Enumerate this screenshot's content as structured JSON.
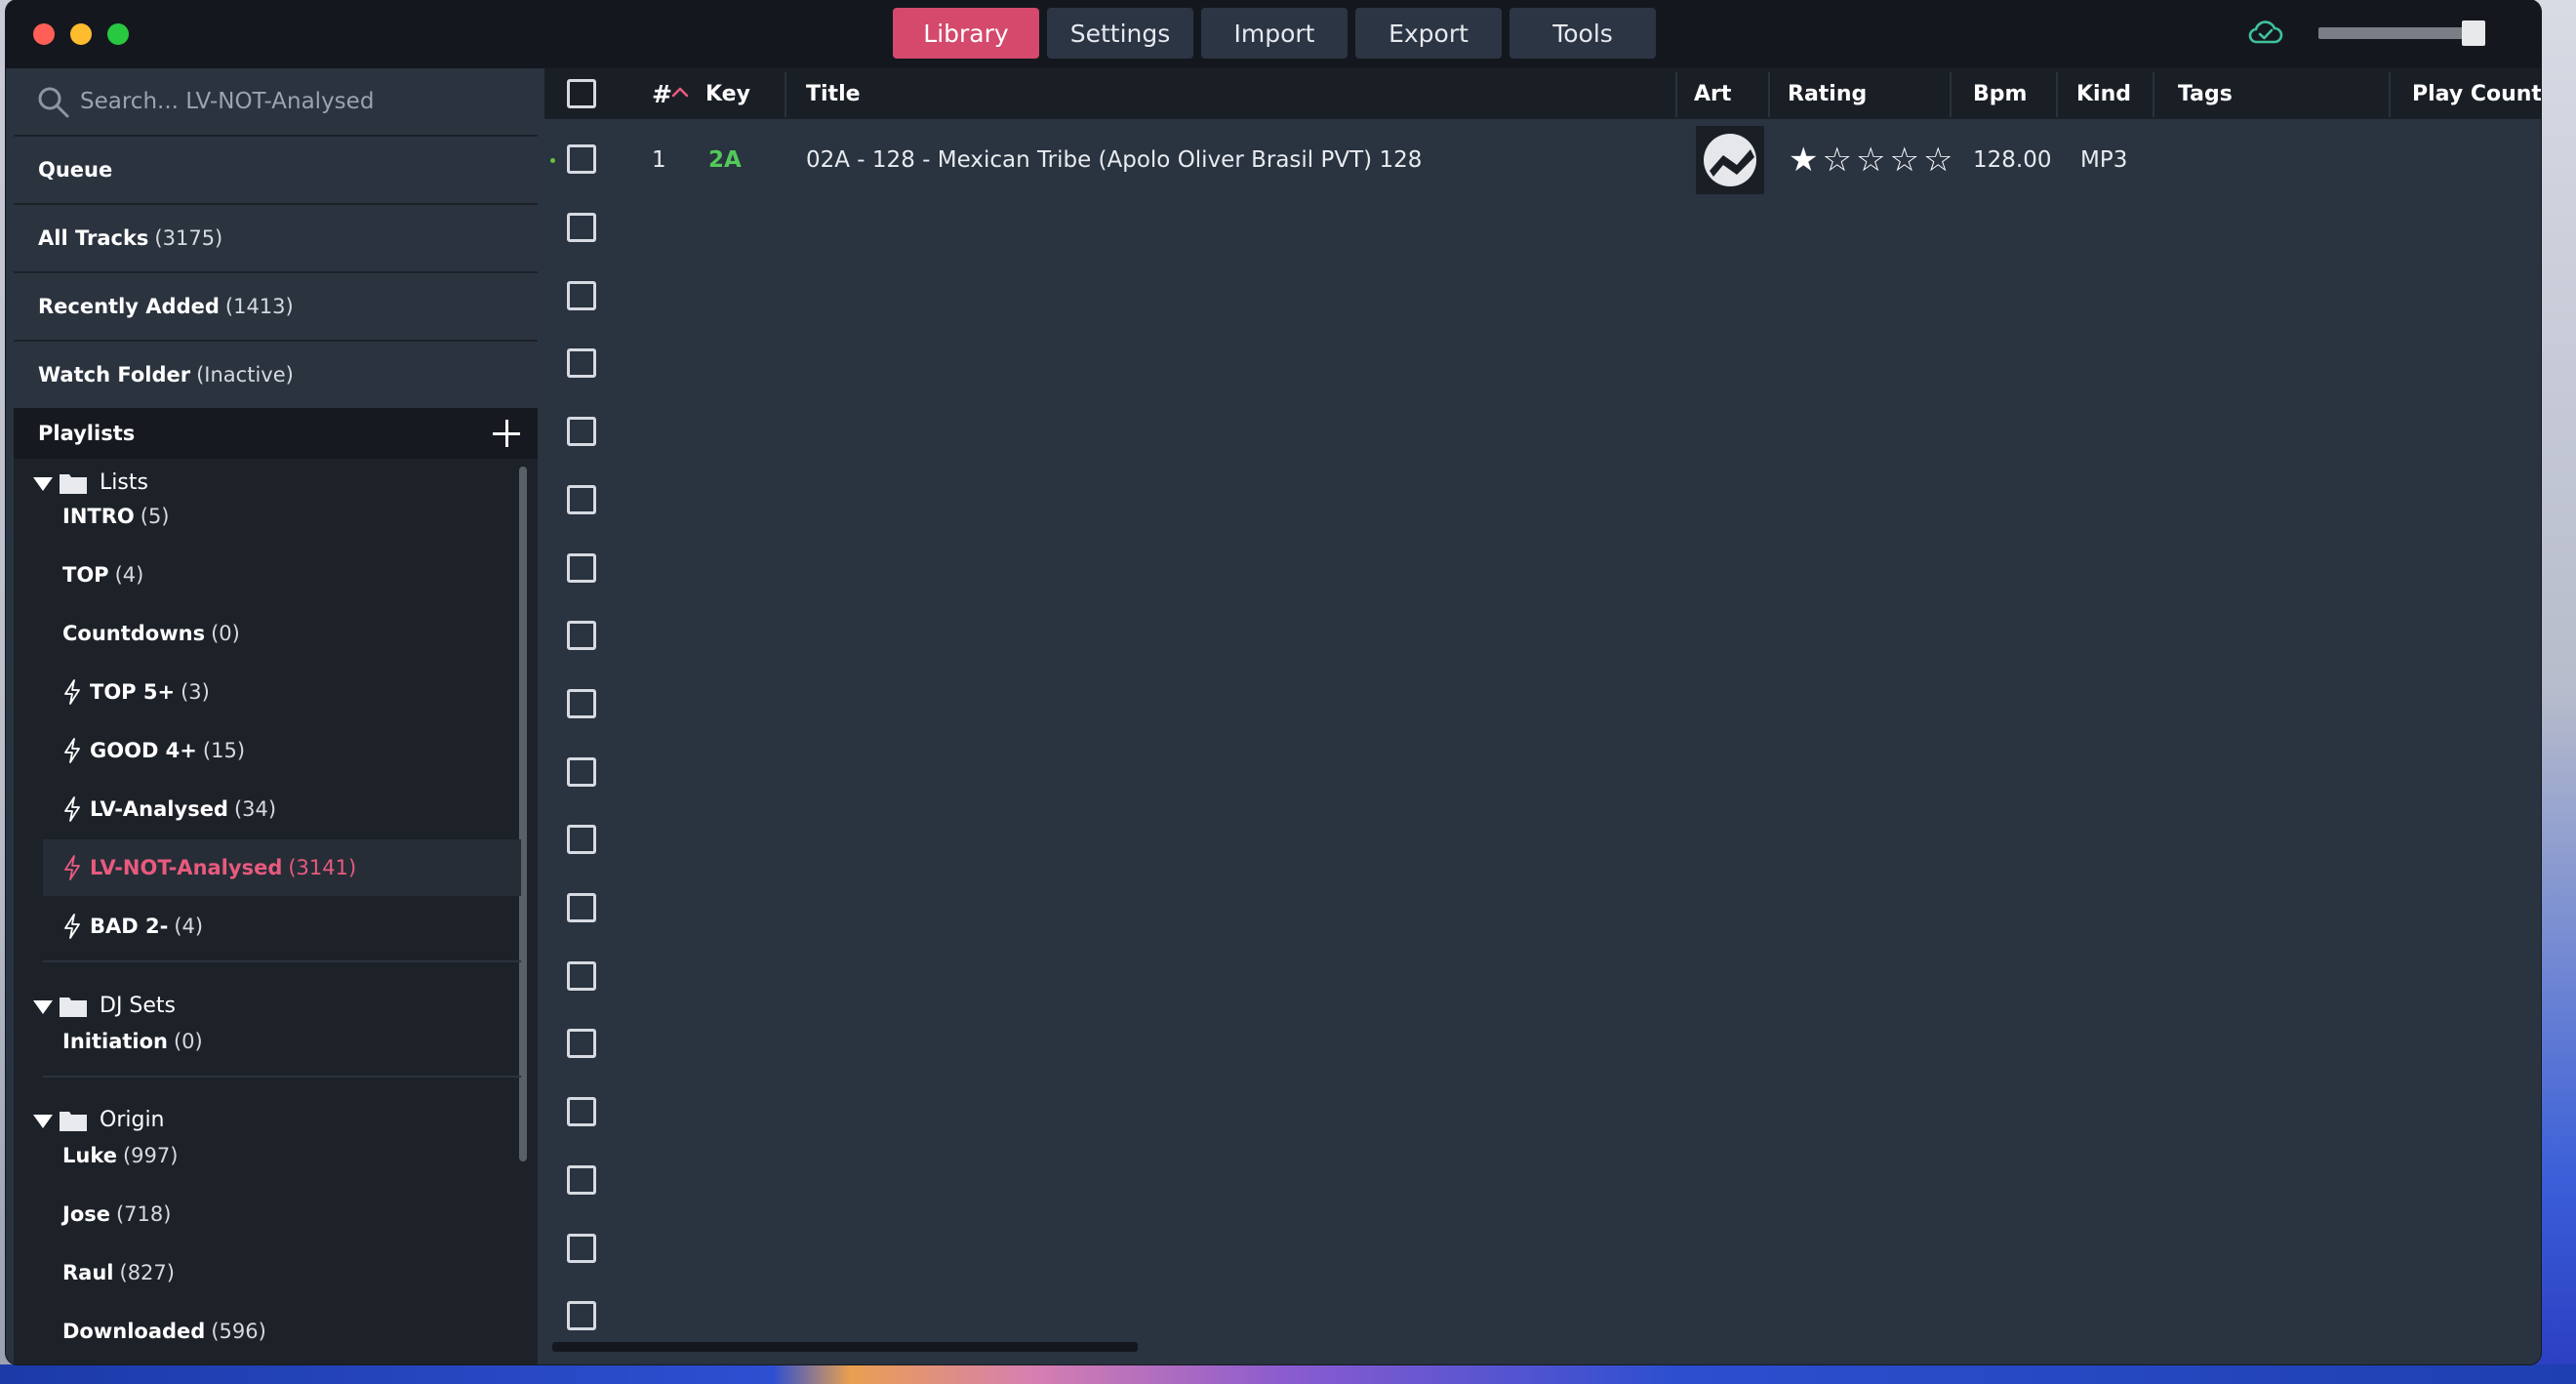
{
  "window": {
    "tabs": [
      {
        "label": "Library",
        "active": true
      },
      {
        "label": "Settings",
        "active": false
      },
      {
        "label": "Import",
        "active": false
      },
      {
        "label": "Export",
        "active": false
      },
      {
        "label": "Tools",
        "active": false
      }
    ],
    "volume_level": 0.9,
    "sync_icon": "cloud-check-icon"
  },
  "sidebar": {
    "search_placeholder": "Search... LV-NOT-Analysed",
    "nav": [
      {
        "label": "Queue",
        "count": ""
      },
      {
        "label": "All Tracks",
        "count": "(3175)"
      },
      {
        "label": "Recently Added",
        "count": "(1413)"
      },
      {
        "label": "Watch Folder",
        "count": "(Inactive)"
      }
    ],
    "playlists_header": "Playlists",
    "folders": [
      {
        "name": "Lists",
        "items": [
          {
            "label": "INTRO",
            "count": "(5)",
            "smart": false,
            "selected": false
          },
          {
            "label": "TOP",
            "count": "(4)",
            "smart": false,
            "selected": false
          },
          {
            "label": "Countdowns",
            "count": "(0)",
            "smart": false,
            "selected": false
          },
          {
            "label": "TOP 5+",
            "count": "(3)",
            "smart": true,
            "selected": false
          },
          {
            "label": "GOOD 4+",
            "count": "(15)",
            "smart": true,
            "selected": false
          },
          {
            "label": "LV-Analysed",
            "count": "(34)",
            "smart": true,
            "selected": false
          },
          {
            "label": "LV-NOT-Analysed",
            "count": "(3141)",
            "smart": true,
            "selected": true
          },
          {
            "label": "BAD 2-",
            "count": "(4)",
            "smart": true,
            "selected": false
          }
        ]
      },
      {
        "name": "DJ Sets",
        "items": [
          {
            "label": "Initiation",
            "count": "(0)",
            "smart": false,
            "selected": false
          }
        ]
      },
      {
        "name": "Origin",
        "items": [
          {
            "label": "Luke",
            "count": "(997)",
            "smart": false,
            "selected": false
          },
          {
            "label": "Jose",
            "count": "(718)",
            "smart": false,
            "selected": false
          },
          {
            "label": "Raul",
            "count": "(827)",
            "smart": false,
            "selected": false
          },
          {
            "label": "Downloaded",
            "count": "(596)",
            "smart": false,
            "selected": false
          }
        ]
      }
    ]
  },
  "table": {
    "columns": {
      "num": "#",
      "key": "Key",
      "title": "Title",
      "art": "Art",
      "rating": "Rating",
      "bpm": "Bpm",
      "kind": "Kind",
      "tags": "Tags",
      "play_count": "Play Count"
    },
    "sort": {
      "column": "num",
      "direction": "ascending"
    },
    "rows": [
      {
        "num": "1",
        "key": "2A",
        "title": "02A - 128 - Mexican Tribe (Apolo Oliver Brasil PVT) 128",
        "rating": 1,
        "rating_max": 5,
        "bpm": "128.00",
        "kind": "MP3",
        "tags": "",
        "play_count": ""
      }
    ],
    "empty_checkbox_rows": 17
  },
  "colors": {
    "accent": "#d4496c",
    "selected_text": "#e85a7e",
    "key_green": "#52c95a"
  }
}
